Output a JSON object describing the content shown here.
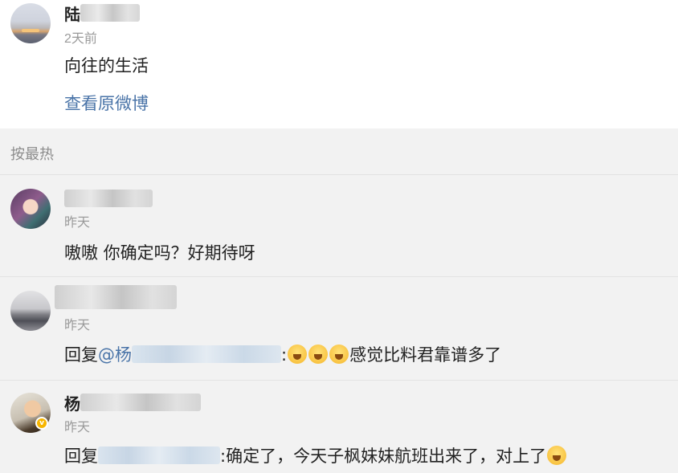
{
  "post": {
    "author_visible": "陆",
    "time": "2天前",
    "text": "向往的生活",
    "view_original": "查看原微博"
  },
  "sort": {
    "label": "按最热"
  },
  "comments": [
    {
      "time": "昨天",
      "text": "嗷嗷 你确定吗？好期待呀"
    },
    {
      "time": "昨天",
      "reply_prefix": "回复",
      "mention_prefix": "@杨",
      "separator": ":",
      "text": "感觉比料君靠谱多了"
    },
    {
      "author_visible": "杨",
      "time": "昨天",
      "reply_prefix": "回复",
      "separator": ":",
      "text": "确定了，今天子枫妹妹航班出来了，对上了",
      "verified_badge": "v"
    }
  ],
  "icons": {
    "emoji_face": "grinning-emoji",
    "emoji_thinking": "thinking-emoji"
  }
}
